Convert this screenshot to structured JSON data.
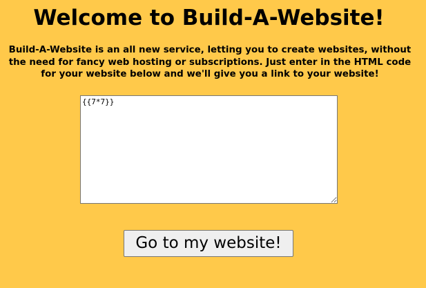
{
  "header": {
    "title": "Welcome to Build-A-Website!"
  },
  "intro": {
    "text": "Build-A-Website is an all new service, letting you to create websites, without the need for fancy web hosting or subscriptions. Just enter in the HTML code for your website below and we'll give you a link to your website!"
  },
  "form": {
    "html_value": "{{7*7}}",
    "submit_label": "Go to my website!"
  },
  "colors": {
    "background": "#ffc94a",
    "textarea_bg": "#ffffff",
    "button_bg": "#efefef"
  }
}
